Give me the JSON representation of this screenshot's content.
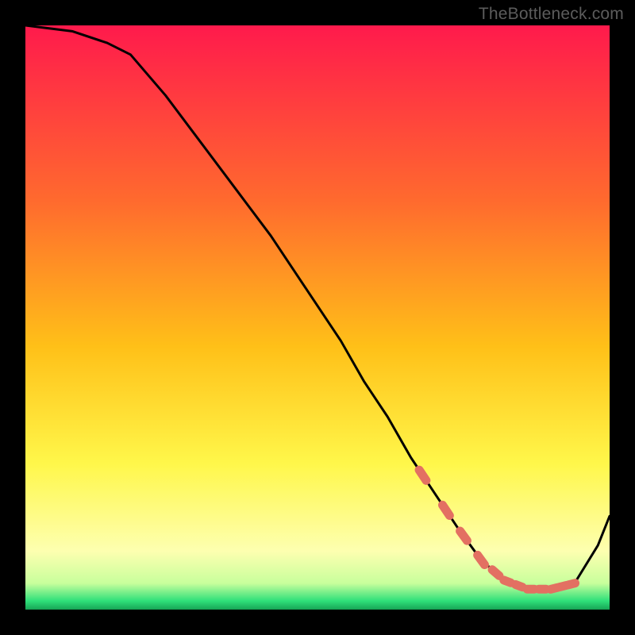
{
  "watermark": "TheBottleneck.com",
  "colors": {
    "black": "#000000",
    "curve": "#000000",
    "marker": "#e37062",
    "grad_top": "#ff1a4c",
    "grad_mid": "#ffd400",
    "grad_low": "#ffff8a",
    "grad_green": "#2fe07a"
  },
  "chart_data": {
    "type": "line",
    "title": "",
    "xlabel": "",
    "ylabel": "",
    "xlim": [
      0,
      100
    ],
    "ylim": [
      0,
      100
    ],
    "curve": {
      "name": "bottleneck-curve",
      "x": [
        0,
        8,
        14,
        18,
        24,
        30,
        36,
        42,
        48,
        54,
        58,
        62,
        66,
        70,
        74,
        78,
        82,
        86,
        90,
        94,
        98,
        100
      ],
      "y": [
        100,
        99,
        97,
        95,
        88,
        80,
        72,
        64,
        55,
        46,
        39,
        33,
        26,
        20,
        14,
        8.5,
        5,
        3.5,
        3.5,
        4.5,
        11,
        16
      ]
    },
    "markers": {
      "name": "highlighted-points",
      "x": [
        68,
        72,
        75,
        78,
        80.5,
        82.5,
        84.5,
        86.5,
        88.5,
        90.5,
        92,
        93.5
      ],
      "y": [
        15,
        11,
        8,
        6,
        5.2,
        4.6,
        4.1,
        3.7,
        3.5,
        3.6,
        4.0,
        4.8
      ]
    },
    "gradient_background": {
      "stops": [
        {
          "offset": 0.0,
          "color": "#ff1a4c"
        },
        {
          "offset": 0.3,
          "color": "#ff6a2e"
        },
        {
          "offset": 0.55,
          "color": "#ffc018"
        },
        {
          "offset": 0.75,
          "color": "#fff74a"
        },
        {
          "offset": 0.9,
          "color": "#fdffb0"
        },
        {
          "offset": 0.955,
          "color": "#c8ff9c"
        },
        {
          "offset": 0.985,
          "color": "#2fe07a"
        },
        {
          "offset": 1.0,
          "color": "#17a455"
        }
      ]
    }
  }
}
